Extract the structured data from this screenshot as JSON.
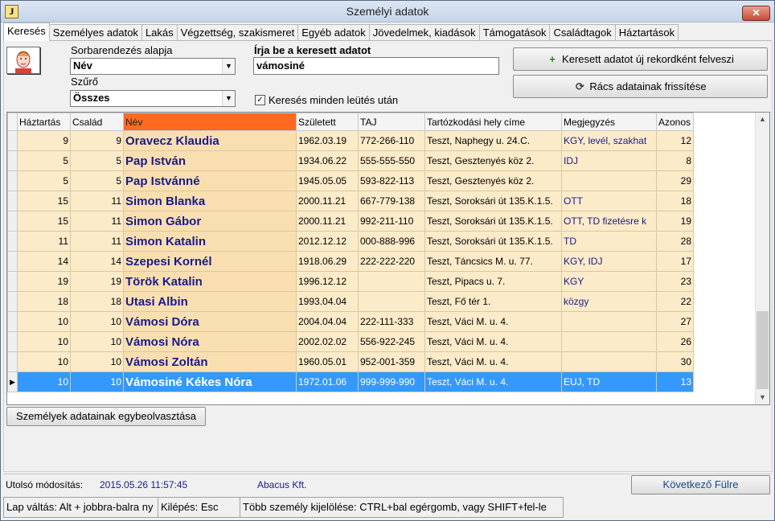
{
  "window": {
    "title": "Személyi adatok",
    "icon_letter": "J",
    "close_label": "✕"
  },
  "tabs": [
    "Keresés",
    "Személyes adatok",
    "Lakás",
    "Végzettség, szakismeret",
    "Egyéb adatok",
    "Jövedelmek, kiadások",
    "Támogatások",
    "Családtagok",
    "Háztartások"
  ],
  "search": {
    "sort_label": "Sorbarendezés alapja",
    "sort_value": "Név",
    "filter_label": "Szűrő",
    "filter_value": "Összes",
    "query_label": "Írja be a keresett adatot",
    "query_value": "vámosiné",
    "search_each_keystroke_label": "Keresés minden leütés után",
    "search_each_keystroke_checked": true,
    "add_record_label": "Keresett adatot új rekordként felveszi",
    "refresh_grid_label": "Rács adatainak frissítése"
  },
  "grid": {
    "columns": [
      "Háztartás",
      "Család",
      "Név",
      "Született",
      "TAJ",
      "Tartózkodási hely címe",
      "Megjegyzés",
      "Azonos"
    ],
    "sorted_column": "Név",
    "rows": [
      [
        "9",
        "9",
        "Oravecz Klaudia",
        "1962.03.19",
        "772-266-110",
        "Teszt, Naphegy u. 24.C.",
        "KGY, levél, szakhat",
        "12"
      ],
      [
        "5",
        "5",
        "Pap István",
        "1934.06.22",
        "555-555-550",
        "Teszt, Gesztenyés köz 2.",
        "IDJ",
        "8"
      ],
      [
        "5",
        "5",
        "Pap Istvánné",
        "1945.05.05",
        "593-822-113",
        "Teszt, Gesztenyés köz 2.",
        "",
        "29"
      ],
      [
        "15",
        "11",
        "Simon Blanka",
        "2000.11.21",
        "667-779-138",
        "Teszt, Soroksári út 135.K.1.5.",
        "OTT",
        "18"
      ],
      [
        "15",
        "11",
        "Simon Gábor",
        "2000.11.21",
        "992-211-110",
        "Teszt, Soroksári út 135.K.1.5.",
        "OTT, TD fizetésre k",
        "19"
      ],
      [
        "11",
        "11",
        "Simon Katalin",
        "2012.12.12",
        "000-888-996",
        "Teszt, Soroksári út 135.K.1.5.",
        "TD",
        "28"
      ],
      [
        "14",
        "14",
        "Szepesi Kornél",
        "1918.06.29",
        "222-222-220",
        "Teszt, Táncsics M. u. 77.",
        "KGY, IDJ",
        "17"
      ],
      [
        "19",
        "19",
        "Török Katalin",
        "1996.12.12",
        "",
        "Teszt, Pipacs u. 7.",
        "KGY",
        "23"
      ],
      [
        "18",
        "18",
        "Utasi Albin",
        "1993.04.04",
        "",
        "Teszt, Fő tér 1.",
        "közgy",
        "22"
      ],
      [
        "10",
        "10",
        "Vámosi Dóra",
        "2004.04.04",
        "222-111-333",
        "Teszt, Váci M. u. 4.",
        "",
        "27"
      ],
      [
        "10",
        "10",
        "Vámosi Nóra",
        "2002.02.02",
        "556-922-245",
        "Teszt, Váci M. u. 4.",
        "",
        "26"
      ],
      [
        "10",
        "10",
        "Vámosi Zoltán",
        "1960.05.01",
        "952-001-359",
        "Teszt, Váci M. u. 4.",
        "",
        "30"
      ],
      [
        "10",
        "10",
        "Vámosiné Kékes Nóra",
        "1972.01.06",
        "999-999-990",
        "Teszt, Váci M. u. 4.",
        "EUJ, TD",
        "13"
      ]
    ],
    "selected_row": 12
  },
  "merge_button_label": "Személyek adatainak egybeolvasztása",
  "status": {
    "last_modified_label": "Utolsó módosítás:",
    "last_modified_value": "2015.05.26 11:57:45",
    "company": "Abacus Kft.",
    "next_tab_label": "Következő Fülre",
    "hint_tab_switch": "Lap váltás: Alt + jobbra-balra ny",
    "hint_exit": "Kilépés: Esc",
    "hint_multiselect": "Több személy kijelölése: CTRL+bal egérgomb, vagy SHIFT+fel-le"
  },
  "colors": {
    "sorted_header": "#ff6a20",
    "selection": "#3399ff",
    "name_text": "#1a1a8c",
    "row_bg": "#fcebc9"
  }
}
